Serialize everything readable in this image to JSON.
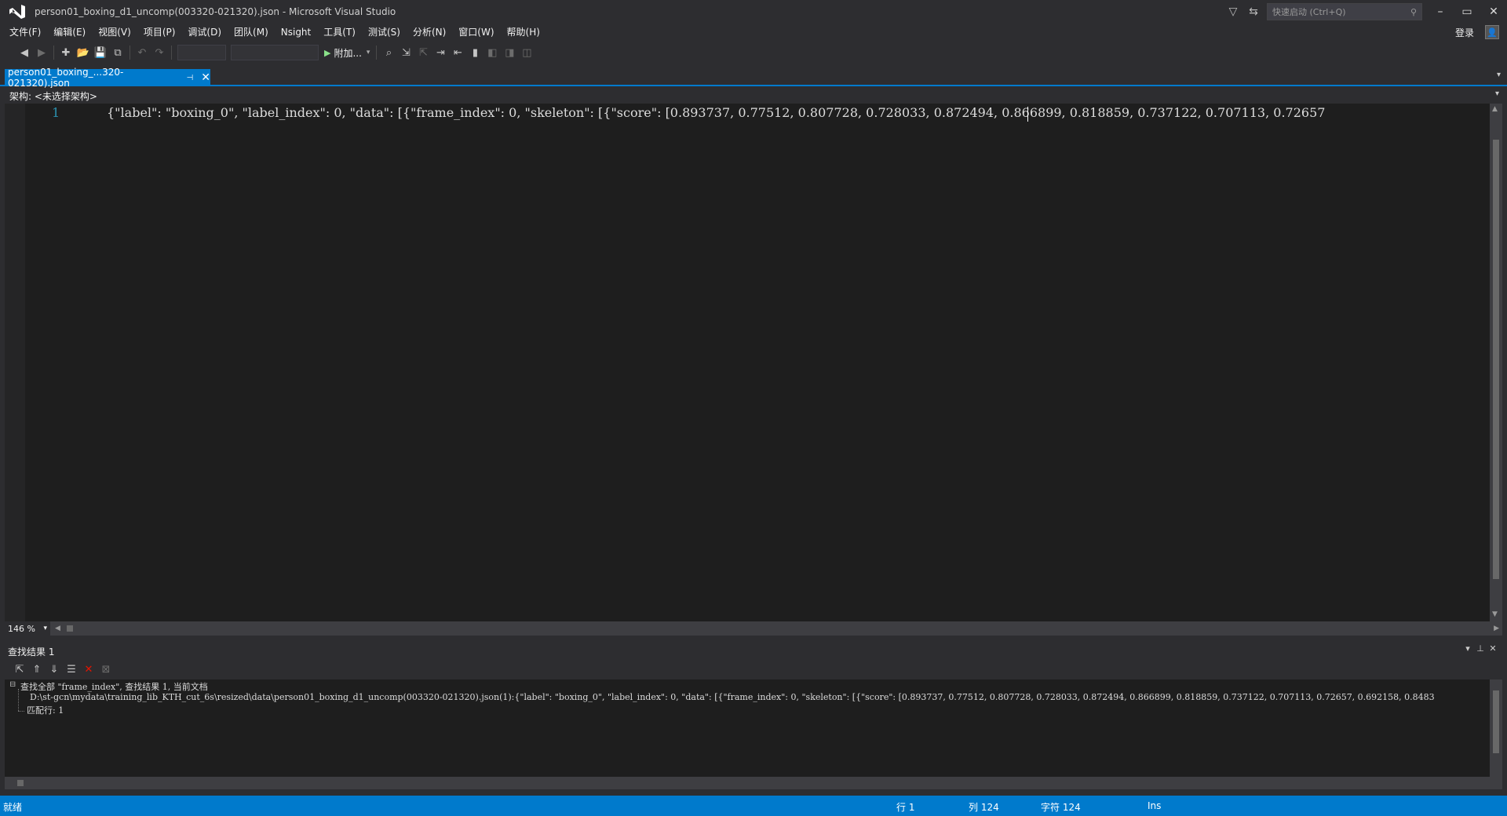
{
  "window": {
    "title": "person01_boxing_d1_uncomp(003320-021320).json - Microsoft Visual Studio",
    "quick_launch_placeholder": "快速启动 (Ctrl+Q)"
  },
  "menu": {
    "items": [
      "文件(F)",
      "编辑(E)",
      "视图(V)",
      "项目(P)",
      "调试(D)",
      "团队(M)",
      "Nsight",
      "工具(T)",
      "测试(S)",
      "分析(N)",
      "窗口(W)",
      "帮助(H)"
    ],
    "login": "登录"
  },
  "toolbar": {
    "attach_label": "附加...",
    "icons": [
      "back-icon",
      "forward-icon",
      "new-project-icon",
      "open-file-icon",
      "save-icon",
      "save-all-icon",
      "undo-icon",
      "redo-icon",
      "play-icon",
      "bookmark-icon"
    ]
  },
  "editor": {
    "tab_label": "person01_boxing_...320-021320).json",
    "nav_label": "架构: <未选择架构>",
    "line_number": "1",
    "code_line": "{\"label\": \"boxing_0\", \"label_index\": 0, \"data\": [{\"frame_index\": 0, \"skeleton\": [{\"score\": [0.893737, 0.77512, 0.807728, 0.728033, 0.872494, 0.866899, 0.818859, 0.737122, 0.707113, 0.72657",
    "zoom": "146 %"
  },
  "find_results": {
    "title": "查找结果 1",
    "summary": "查找全部 \"frame_index\", 查找结果 1, 当前文档",
    "result_line": "D:\\st-gcn\\mydata\\training_lib_KTH_cut_6s\\resized\\data\\person01_boxing_d1_uncomp(003320-021320).json(1):{\"label\": \"boxing_0\", \"label_index\": 0, \"data\": [{\"frame_index\": 0, \"skeleton\": [{\"score\": [0.893737, 0.77512, 0.807728, 0.728033, 0.872494, 0.866899, 0.818859, 0.737122, 0.707113, 0.72657, 0.692158, 0.8483",
    "match_count": "匹配行: 1"
  },
  "status": {
    "ready": "就绪",
    "row": "行 1",
    "col": "列 124",
    "char": "字符 124",
    "mode": "Ins"
  },
  "colors": {
    "accent": "#007acc",
    "background": "#2d2d30",
    "editor_bg": "#1e1e1e"
  }
}
